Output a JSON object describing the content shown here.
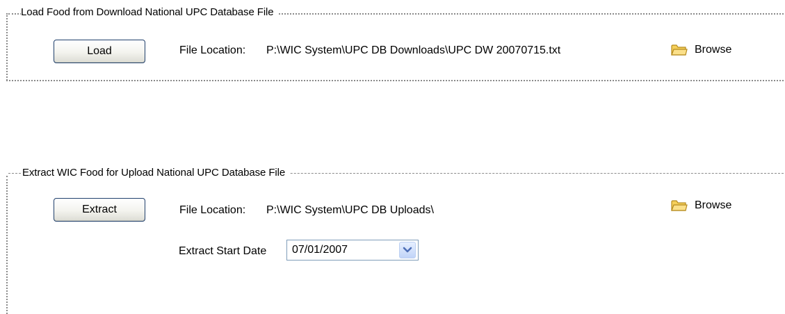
{
  "load_section": {
    "title": "Load Food from Download National UPC Database File",
    "button_label": "Load",
    "file_location_label": "File Location:",
    "file_location_value": "P:\\WIC System\\UPC DB Downloads\\UPC DW 20070715.txt",
    "browse_label": "Browse"
  },
  "extract_section": {
    "title": "Extract WIC Food for Upload National UPC Database File",
    "button_label": "Extract",
    "file_location_label": "File Location:",
    "file_location_value": "P:\\WIC System\\UPC DB Uploads\\",
    "browse_label": "Browse",
    "start_date_label": "Extract Start Date",
    "start_date_value": "07/01/2007"
  },
  "icons": {
    "folder": "folder-icon",
    "dropdown": "chevron-down-icon"
  },
  "colors": {
    "button_border": "#1f3f6b",
    "folder_fill": "#f5cf5a",
    "dropdown_arrow": "#4d6fb7"
  }
}
